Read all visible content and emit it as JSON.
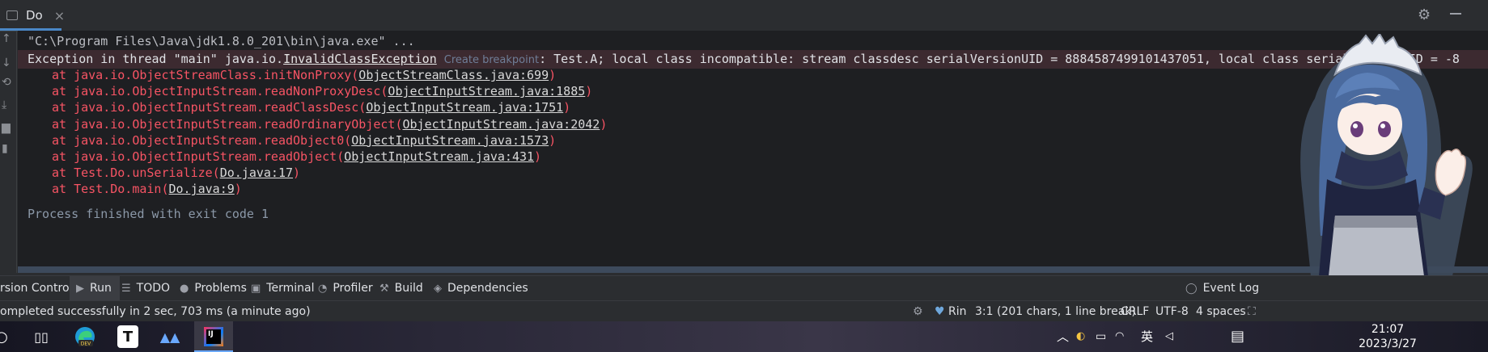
{
  "window": {
    "tab_label": "Do",
    "close_glyph": "×"
  },
  "console": {
    "cmd_line": "\"C:\\Program Files\\Java\\jdk1.8.0_201\\bin\\java.exe\" ...",
    "exception": {
      "prefix": "Exception in thread \"main\" java.io.",
      "class_name": "InvalidClassException",
      "breakpoint_hint": "Create breakpoint",
      "message": ": Test.A; local class incompatible: stream classdesc serialVersionUID = 8884587499101437051, local class serialVersionUID = -8"
    },
    "stack": [
      {
        "at": "at java.io.ObjectStreamClass.initNonProxy(",
        "link": "ObjectStreamClass.java:699",
        "end": ")"
      },
      {
        "at": "at java.io.ObjectInputStream.readNonProxyDesc(",
        "link": "ObjectInputStream.java:1885",
        "end": ")"
      },
      {
        "at": "at java.io.ObjectInputStream.readClassDesc(",
        "link": "ObjectInputStream.java:1751",
        "end": ")"
      },
      {
        "at": "at java.io.ObjectInputStream.readOrdinaryObject(",
        "link": "ObjectInputStream.java:2042",
        "end": ")"
      },
      {
        "at": "at java.io.ObjectInputStream.readObject0(",
        "link": "ObjectInputStream.java:1573",
        "end": ")"
      },
      {
        "at": "at java.io.ObjectInputStream.readObject(",
        "link": "ObjectInputStream.java:431",
        "end": ")"
      },
      {
        "at": "at Test.Do.unSerialize(",
        "link": "Do.java:17",
        "end": ")"
      },
      {
        "at": "at Test.Do.main(",
        "link": "Do.java:9",
        "end": ")"
      }
    ],
    "exit_line": "Process finished with exit code 1"
  },
  "toolwindows": {
    "version_control": "rsion Control",
    "run": "Run",
    "todo": "TODO",
    "problems": "Problems",
    "terminal": "Terminal",
    "profiler": "Profiler",
    "build": "Build",
    "dependencies": "Dependencies",
    "event_log": "Event Log"
  },
  "status": {
    "message": "ompleted successfully in 2 sec, 703 ms (a minute ago)",
    "user": "Rin",
    "position": "3:1 (201 chars, 1 line break)",
    "line_sep": "CRLF",
    "encoding": "UTF-8",
    "indent": "4 spaces"
  },
  "taskbar": {
    "ime": "英",
    "time": "21:07",
    "date": "2023/3/27",
    "typora_letter": "T",
    "idea_letter": "IJ",
    "edge_badge": "DEV"
  },
  "colors": {
    "error": "#f75464",
    "console_bg": "#1e1f22",
    "panel_bg": "#2b2d30",
    "accent": "#4a88c7"
  },
  "icons": [
    "config-icon",
    "gear-icon",
    "minimize-icon",
    "rerun-icon",
    "stop-icon",
    "scroll-icon",
    "print-icon",
    "trash-icon",
    "play-icon",
    "list-icon",
    "problems-icon",
    "terminal-icon",
    "profiler-icon",
    "build-icon",
    "dependencies-icon",
    "event-log-icon",
    "heart-icon",
    "start-icon",
    "taskview-icon",
    "edge-icon",
    "typora-icon",
    "cat-icon",
    "intellij-icon",
    "notification-icon"
  ]
}
